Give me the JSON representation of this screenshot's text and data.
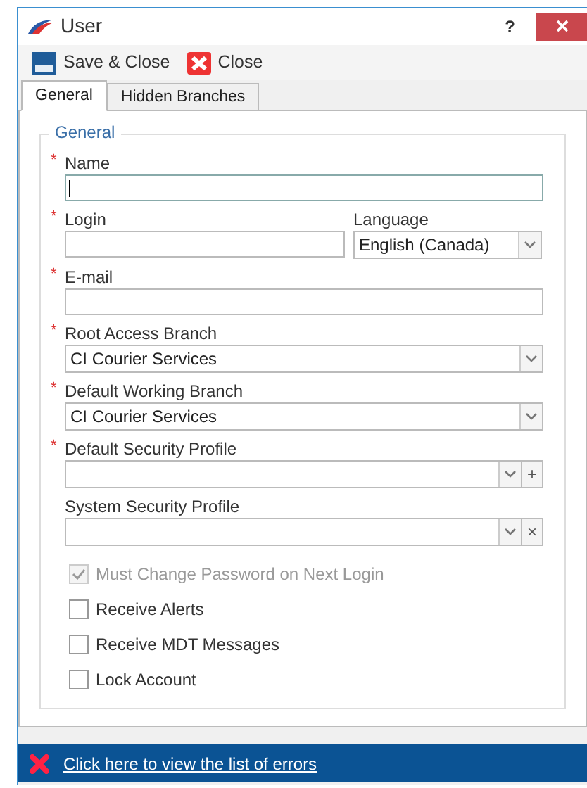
{
  "window": {
    "title": "User",
    "help": "?"
  },
  "toolbar": [
    {
      "kind": "save",
      "label": "Save & Close"
    },
    {
      "kind": "close",
      "label": "Close"
    }
  ],
  "tabs": [
    {
      "label": "General",
      "selected": true
    },
    {
      "label": "Hidden Branches",
      "selected": false
    }
  ],
  "group": {
    "title": "General"
  },
  "rows": [
    [
      {
        "label": "Name",
        "marker": "*",
        "kind": "text",
        "focused": true
      }
    ],
    [
      {
        "label": "Login",
        "marker": "*",
        "kind": "text",
        "focused": false
      },
      {
        "label": "Language",
        "kind": "combo",
        "value": "English (Canada)"
      }
    ],
    [
      {
        "label": "E-mail",
        "marker": "*",
        "kind": "text",
        "focused": false
      }
    ],
    [
      {
        "label": "Root Access Branch",
        "marker": "*",
        "kind": "combo",
        "value": "CI Courier Services"
      }
    ],
    [
      {
        "label": "Default Working Branch",
        "marker": "*",
        "kind": "combo",
        "value": "CI Courier Services"
      }
    ],
    [
      {
        "label": "Default Security Profile",
        "marker": "*",
        "kind": "combo",
        "extra": "+"
      }
    ],
    [
      {
        "label": "System Security Profile",
        "kind": "combo",
        "extra": "×"
      }
    ]
  ],
  "checkboxes": [
    {
      "label": "Must Change Password on Next Login",
      "checked": true,
      "disabled": true
    },
    {
      "label": "Receive Alerts",
      "checked": false,
      "disabled": false
    },
    {
      "label": "Receive MDT Messages",
      "checked": false,
      "disabled": false
    },
    {
      "label": "Lock Account",
      "checked": false,
      "disabled": false
    }
  ],
  "error_bar": {
    "link": "Click here to view the list of errors"
  }
}
